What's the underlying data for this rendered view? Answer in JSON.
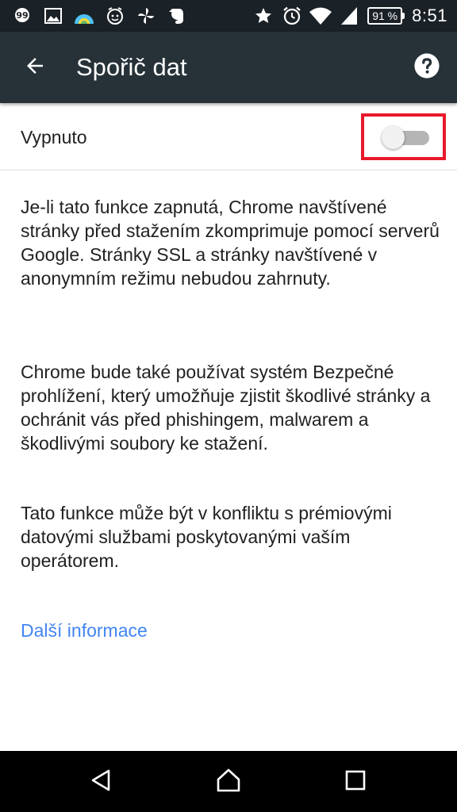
{
  "status_bar": {
    "battery_text": "91 %",
    "time": "8:51",
    "left_icons": [
      "quote-bubble-icon",
      "image-icon",
      "weather-icon",
      "alarm-face-icon",
      "pinwheel-icon",
      "evernote-icon"
    ],
    "right_icons": [
      "star-icon",
      "alarm-clock-icon",
      "wifi-icon",
      "cell-signal-icon",
      "battery-icon"
    ]
  },
  "toolbar": {
    "title": "Spořič dat",
    "back_icon": "arrow-back-icon",
    "help_icon": "help-icon"
  },
  "switch_row": {
    "label": "Vypnuto",
    "state": "off"
  },
  "content": {
    "paragraph_1": "Je-li tato funkce zapnutá, Chrome navštívené stránky před stažením zkomprimuje pomocí serverů Google. Stránky SSL a stránky navštívené v anonymním režimu nebudou zahrnuty.",
    "paragraph_2": "Chrome bude také používat systém Bezpečné prohlížení, který umožňuje zjistit škodlivé stránky a ochránit vás před phishingem, malwarem a škodlivými soubory ke stažení.",
    "paragraph_3": "Tato funkce může být v konfliktu s prémiovými datovými službami poskytovanými vaším operátorem.",
    "learn_more": "Další informace"
  },
  "colors": {
    "status_bar_bg": "#1b2227",
    "toolbar_bg": "#263238",
    "link": "#4285f4",
    "highlight": "#e8192c",
    "text": "#212121"
  },
  "nav_bar": {
    "buttons": [
      "nav-back-icon",
      "nav-home-icon",
      "nav-recent-apps-icon"
    ]
  }
}
